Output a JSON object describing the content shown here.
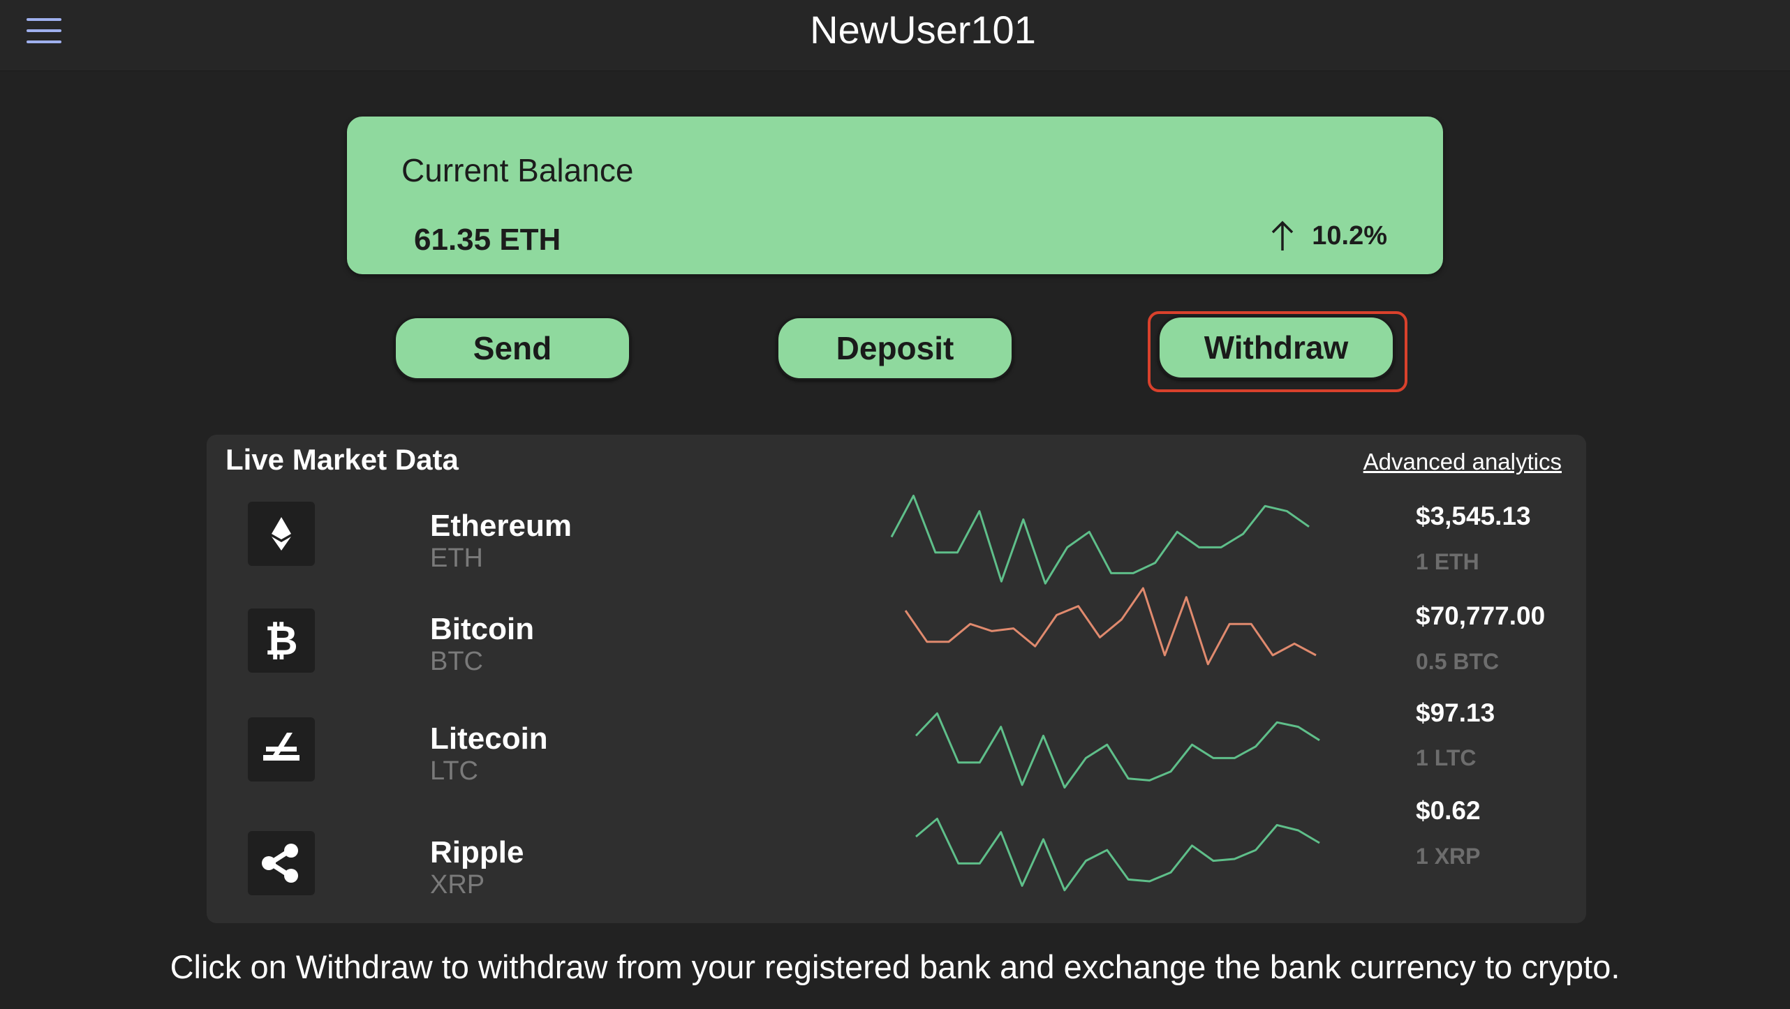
{
  "header": {
    "title": "NewUser101",
    "menu_icon": "hamburger-menu-icon"
  },
  "balance": {
    "label": "Current Balance",
    "value": "61.35 ETH",
    "change": "10.2%",
    "change_icon": "arrow-up-icon"
  },
  "actions": {
    "send": "Send",
    "deposit": "Deposit",
    "withdraw": "Withdraw",
    "highlight_color": "#d9412c"
  },
  "market": {
    "title": "Live Market Data",
    "advanced_link": "Advanced analytics",
    "coins": [
      {
        "name": "Ethereum",
        "symbol": "ETH",
        "price": "$3,545.13",
        "holding": "1 ETH",
        "icon": "ethereum-icon",
        "trend_color": "#5fbf8a",
        "trend": [
          0.45,
          0.05,
          0.6,
          0.6,
          0.2,
          0.88,
          0.28,
          0.9,
          0.55,
          0.4,
          0.8,
          0.8,
          0.7,
          0.4,
          0.55,
          0.55,
          0.42,
          0.15,
          0.2,
          0.35
        ]
      },
      {
        "name": "Bitcoin",
        "symbol": "BTC",
        "price": "$70,777.00",
        "holding": "0.5 BTC",
        "icon": "bitcoin-icon",
        "trend_color": "#e08a6e",
        "trend": [
          0.25,
          0.6,
          0.6,
          0.4,
          0.48,
          0.45,
          0.65,
          0.3,
          0.2,
          0.55,
          0.35,
          0.0,
          0.75,
          0.1,
          0.85,
          0.4,
          0.4,
          0.75,
          0.62,
          0.75
        ]
      },
      {
        "name": "Litecoin",
        "symbol": "LTC",
        "price": "$97.13",
        "holding": "1 LTC",
        "icon": "litecoin-icon",
        "trend_color": "#5fbf8a",
        "trend": [
          0.3,
          0.05,
          0.6,
          0.6,
          0.2,
          0.85,
          0.3,
          0.88,
          0.55,
          0.4,
          0.78,
          0.8,
          0.7,
          0.4,
          0.55,
          0.55,
          0.42,
          0.15,
          0.2,
          0.35
        ]
      },
      {
        "name": "Ripple",
        "symbol": "XRP",
        "price": "$0.62",
        "holding": "1 XRP",
        "icon": "ripple-icon",
        "trend_color": "#5fbf8a",
        "trend": [
          0.25,
          0.05,
          0.55,
          0.55,
          0.2,
          0.8,
          0.28,
          0.85,
          0.52,
          0.4,
          0.73,
          0.75,
          0.65,
          0.35,
          0.52,
          0.5,
          0.4,
          0.12,
          0.18,
          0.32
        ]
      }
    ]
  },
  "instruction": "Click on Withdraw to withdraw from your registered bank and exchange the bank currency to crypto."
}
